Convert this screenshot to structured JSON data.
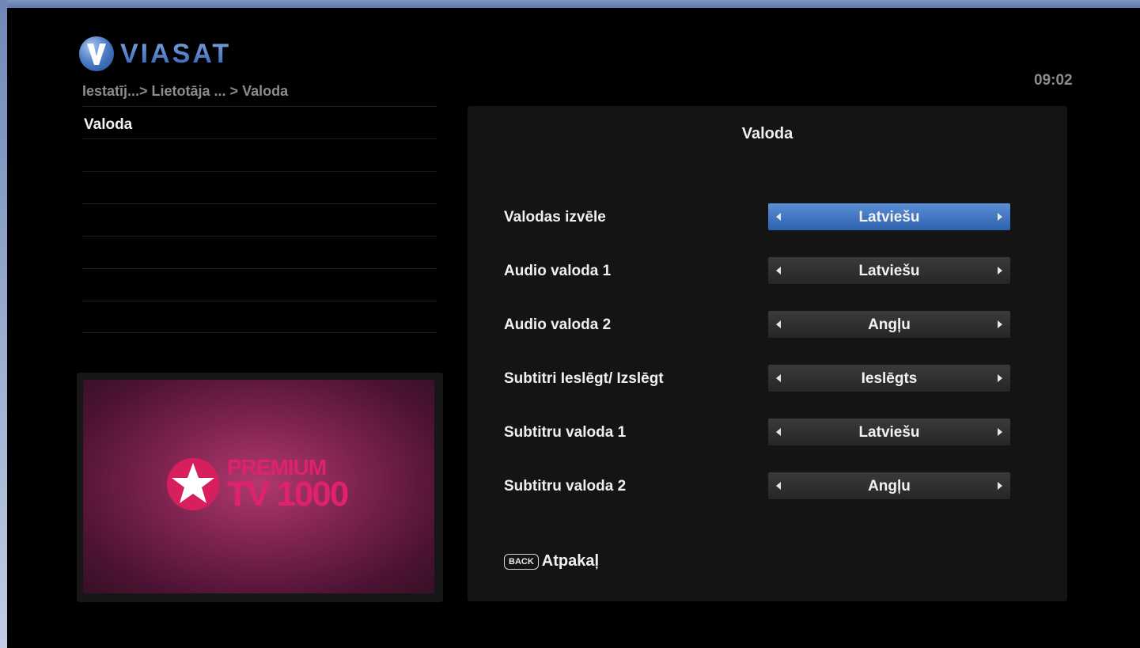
{
  "brand": {
    "name": "VIASAT",
    "icon": "viasat-v-logo"
  },
  "breadcrumb": "Iestatīj...> Lietotāja ... > Valoda",
  "clock": "09:02",
  "menu": {
    "items": [
      {
        "label": "Valoda"
      },
      {
        "label": ""
      },
      {
        "label": ""
      },
      {
        "label": ""
      },
      {
        "label": ""
      },
      {
        "label": ""
      },
      {
        "label": ""
      }
    ]
  },
  "preview": {
    "channel_line1": "PREMIUM",
    "channel_line2": "TV 1000",
    "icon": "star-logo"
  },
  "panel": {
    "title": "Valoda",
    "settings": [
      {
        "label": "Valodas izvēle",
        "value": "Latviešu",
        "active": true
      },
      {
        "label": "Audio valoda 1",
        "value": "Latviešu",
        "active": false
      },
      {
        "label": "Audio valoda 2",
        "value": "Angļu",
        "active": false
      },
      {
        "label": "Subtitri Ieslēgt/ Izslēgt",
        "value": "Ieslēgts",
        "active": false
      },
      {
        "label": "Subtitru valoda 1",
        "value": "Latviešu",
        "active": false
      },
      {
        "label": "Subtitru valoda 2",
        "value": "Angļu",
        "active": false
      }
    ],
    "back_key": "BACK",
    "back_label": "Atpakaļ"
  },
  "colors": {
    "accent": "#3f6fc0",
    "active_selector": "#4a7fc8",
    "channel_pink": "#e0216b"
  }
}
